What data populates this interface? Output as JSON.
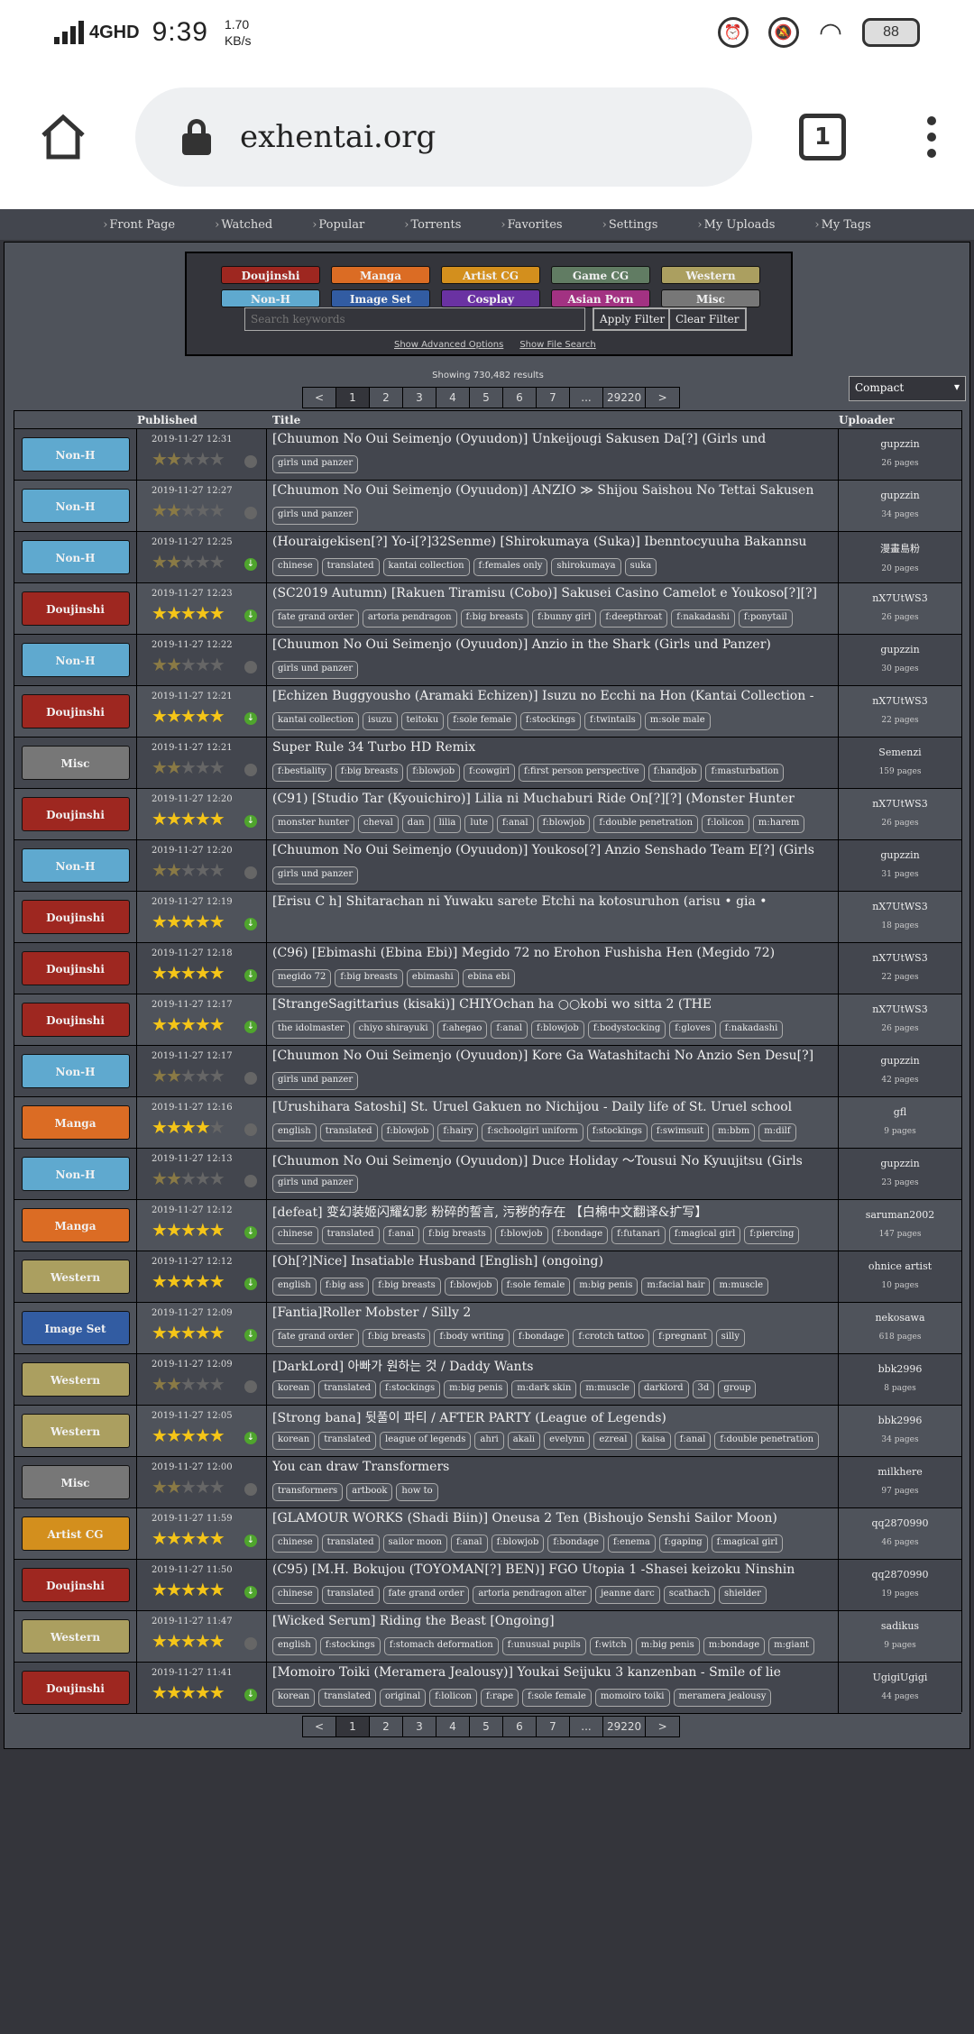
{
  "status": {
    "network": "4GHD",
    "time": "9:39",
    "speed_top": "1.70",
    "speed_bottom": "KB/s",
    "battery": "88"
  },
  "browser": {
    "url": "exhentai.org",
    "tab_count": "1"
  },
  "nav": [
    "Front Page",
    "Watched",
    "Popular",
    "Torrents",
    "Favorites",
    "Settings",
    "My Uploads",
    "My Tags"
  ],
  "categories": [
    {
      "label": "Doujinshi",
      "color": "#9e2720"
    },
    {
      "label": "Manga",
      "color": "#db6c24"
    },
    {
      "label": "Artist CG",
      "color": "#d38f1d"
    },
    {
      "label": "Game CG",
      "color": "#617c63"
    },
    {
      "label": "Western",
      "color": "#ab9f60"
    },
    {
      "label": "Non-H",
      "color": "#5fa9cf"
    },
    {
      "label": "Image Set",
      "color": "#325ca2"
    },
    {
      "label": "Cosplay",
      "color": "#6a32a2"
    },
    {
      "label": "Asian Porn",
      "color": "#a23282"
    },
    {
      "label": "Misc",
      "color": "#777777"
    }
  ],
  "search": {
    "placeholder": "Search keywords",
    "apply": "Apply Filter",
    "clear": "Clear Filter",
    "advanced": "Show Advanced Options",
    "file": "Show File Search"
  },
  "showing": "Showing 730,482 results",
  "pager": [
    "<",
    "1",
    "2",
    "3",
    "4",
    "5",
    "6",
    "7",
    "...",
    "29220",
    ">"
  ],
  "view_mode": "Compact",
  "columns": {
    "published": "Published",
    "title": "Title",
    "uploader": "Uploader"
  },
  "rows": [
    {
      "cat": "Non-H",
      "color": "#5fa9cf",
      "date": "2019-11-27 12:31",
      "rating": 2,
      "dl": false,
      "title": "[Chuumon No Oui Seimenjo (Oyuudon)] Unkeijougi Sakusen Da[?] (Girls und",
      "tags": [
        "girls und panzer"
      ],
      "uploader": "gupzzin",
      "pages": "26 pages"
    },
    {
      "cat": "Non-H",
      "color": "#5fa9cf",
      "date": "2019-11-27 12:27",
      "rating": 2,
      "dl": false,
      "title": "[Chuumon No Oui Seimenjo (Oyuudon)] ANZIO ≫ Shijou Saishou No Tettai Sakusen",
      "tags": [
        "girls und panzer"
      ],
      "uploader": "gupzzin",
      "pages": "34 pages"
    },
    {
      "cat": "Non-H",
      "color": "#5fa9cf",
      "date": "2019-11-27 12:25",
      "rating": 2,
      "dl": true,
      "title": "(Houraigekisen[?] Yo-i[?]32Senme) [Shirokumaya (Suka)] Ibenntocyuuha Bakannsu",
      "tags": [
        "chinese",
        "translated",
        "kantai collection",
        "f:females only",
        "shirokumaya",
        "suka"
      ],
      "uploader": "漫畫島粉",
      "pages": "20 pages"
    },
    {
      "cat": "Doujinshi",
      "color": "#9e2720",
      "date": "2019-11-27 12:23",
      "rating": 5,
      "dl": true,
      "title": "(SC2019 Autumn) [Rakuen Tiramisu (Cobo)] Sakusei Casino Camelot e Youkoso[?][?]",
      "tags": [
        "fate grand order",
        "artoria pendragon",
        "f:big breasts",
        "f:bunny girl",
        "f:deepthroat",
        "f:nakadashi",
        "f:ponytail"
      ],
      "uploader": "nX7UtWS3",
      "pages": "26 pages"
    },
    {
      "cat": "Non-H",
      "color": "#5fa9cf",
      "date": "2019-11-27 12:22",
      "rating": 2,
      "dl": false,
      "title": "[Chuumon No Oui Seimenjo (Oyuudon)] Anzio in the Shark (Girls und Panzer)",
      "tags": [
        "girls und panzer"
      ],
      "uploader": "gupzzin",
      "pages": "30 pages"
    },
    {
      "cat": "Doujinshi",
      "color": "#9e2720",
      "date": "2019-11-27 12:21",
      "rating": 5,
      "dl": true,
      "title": "[Echizen Buggyousho (Aramaki Echizen)] Isuzu no Ecchi na Hon (Kantai Collection -",
      "tags": [
        "kantai collection",
        "isuzu",
        "teitoku",
        "f:sole female",
        "f:stockings",
        "f:twintails",
        "m:sole male"
      ],
      "uploader": "nX7UtWS3",
      "pages": "22 pages"
    },
    {
      "cat": "Misc",
      "color": "#777777",
      "date": "2019-11-27 12:21",
      "rating": 2,
      "dl": false,
      "title": "Super Rule 34 Turbo HD Remix",
      "tags": [
        "f:bestiality",
        "f:big breasts",
        "f:blowjob",
        "f:cowgirl",
        "f:first person perspective",
        "f:handjob",
        "f:masturbation"
      ],
      "uploader": "Semenzi",
      "pages": "159 pages"
    },
    {
      "cat": "Doujinshi",
      "color": "#9e2720",
      "date": "2019-11-27 12:20",
      "rating": 5,
      "dl": true,
      "title": "(C91) [Studio Tar (Kyouichiro)] Lilia ni Muchaburi Ride On[?][?] (Monster Hunter",
      "tags": [
        "monster hunter",
        "cheval",
        "dan",
        "lilia",
        "lute",
        "f:anal",
        "f:blowjob",
        "f:double penetration",
        "f:lolicon",
        "m:harem"
      ],
      "uploader": "nX7UtWS3",
      "pages": "26 pages"
    },
    {
      "cat": "Non-H",
      "color": "#5fa9cf",
      "date": "2019-11-27 12:20",
      "rating": 2,
      "dl": false,
      "title": "[Chuumon No Oui Seimenjo (Oyuudon)] Youkoso[?] Anzio Senshado Team E[?] (Girls",
      "tags": [
        "girls und panzer"
      ],
      "uploader": "gupzzin",
      "pages": "31 pages"
    },
    {
      "cat": "Doujinshi",
      "color": "#9e2720",
      "date": "2019-11-27 12:19",
      "rating": 5,
      "dl": true,
      "title": "[Erisu C h] Shitarachan ni Yuwaku sarete Etchi na kotosuruhon (arisu • gia •",
      "tags": [],
      "uploader": "nX7UtWS3",
      "pages": "18 pages"
    },
    {
      "cat": "Doujinshi",
      "color": "#9e2720",
      "date": "2019-11-27 12:18",
      "rating": 5,
      "dl": true,
      "title": "(C96) [Ebimashi (Ebina Ebi)] Megido 72 no Erohon Fushisha Hen (Megido 72)",
      "tags": [
        "megido 72",
        "f:big breasts",
        "ebimashi",
        "ebina ebi"
      ],
      "uploader": "nX7UtWS3",
      "pages": "22 pages"
    },
    {
      "cat": "Doujinshi",
      "color": "#9e2720",
      "date": "2019-11-27 12:17",
      "rating": 5,
      "dl": true,
      "title": "[StrangeSagittarius (kisaki)] CHIYOchan ha ○○kobi wo sitta 2 (THE",
      "tags": [
        "the idolmaster",
        "chiyo shirayuki",
        "f:ahegao",
        "f:anal",
        "f:blowjob",
        "f:bodystocking",
        "f:gloves",
        "f:nakadashi"
      ],
      "uploader": "nX7UtWS3",
      "pages": "26 pages"
    },
    {
      "cat": "Non-H",
      "color": "#5fa9cf",
      "date": "2019-11-27 12:17",
      "rating": 2,
      "dl": false,
      "title": "[Chuumon No Oui Seimenjo (Oyuudon)] Kore Ga Watashitachi No Anzio Sen Desu[?]",
      "tags": [
        "girls und panzer"
      ],
      "uploader": "gupzzin",
      "pages": "42 pages"
    },
    {
      "cat": "Manga",
      "color": "#db6c24",
      "date": "2019-11-27 12:16",
      "rating": 4,
      "dl": false,
      "title": "[Urushihara Satoshi] St. Uruel Gakuen no Nichijou - Daily life of St. Uruel school",
      "tags": [
        "english",
        "translated",
        "f:blowjob",
        "f:hairy",
        "f:schoolgirl uniform",
        "f:stockings",
        "f:swimsuit",
        "m:bbm",
        "m:dilf"
      ],
      "uploader": "gfl",
      "pages": "9 pages"
    },
    {
      "cat": "Non-H",
      "color": "#5fa9cf",
      "date": "2019-11-27 12:13",
      "rating": 2,
      "dl": false,
      "title": "[Chuumon No Oui Seimenjo (Oyuudon)] Duce Holiday ～Tousui No Kyuujitsu (Girls",
      "tags": [
        "girls und panzer"
      ],
      "uploader": "gupzzin",
      "pages": "23 pages"
    },
    {
      "cat": "Manga",
      "color": "#db6c24",
      "date": "2019-11-27 12:12",
      "rating": 5,
      "dl": true,
      "title": "[defeat] 变幻装姬闪耀幻影 粉碎的誓言, 污秽的存在 【白棉中文翻译&扩写】",
      "tags": [
        "chinese",
        "translated",
        "f:anal",
        "f:big breasts",
        "f:blowjob",
        "f:bondage",
        "f:futanari",
        "f:magical girl",
        "f:piercing"
      ],
      "uploader": "saruman2002",
      "pages": "147 pages"
    },
    {
      "cat": "Western",
      "color": "#ab9f60",
      "date": "2019-11-27 12:12",
      "rating": 5,
      "dl": true,
      "title": "[Oh[?]Nice] Insatiable Husband [English] (ongoing)",
      "tags": [
        "english",
        "f:big ass",
        "f:big breasts",
        "f:blowjob",
        "f:sole female",
        "m:big penis",
        "m:facial hair",
        "m:muscle"
      ],
      "uploader": "ohnice artist",
      "pages": "10 pages"
    },
    {
      "cat": "Image Set",
      "color": "#325ca2",
      "date": "2019-11-27 12:09",
      "rating": 5,
      "dl": true,
      "title": "[Fantia]Roller Mobster / Silly 2",
      "tags": [
        "fate grand order",
        "f:big breasts",
        "f:body writing",
        "f:bondage",
        "f:crotch tattoo",
        "f:pregnant",
        "silly"
      ],
      "uploader": "nekosawa",
      "pages": "618 pages"
    },
    {
      "cat": "Western",
      "color": "#ab9f60",
      "date": "2019-11-27 12:09",
      "rating": 2,
      "dl": false,
      "title": "[DarkLord] 아빠가 원하는 것 / Daddy Wants",
      "tags": [
        "korean",
        "translated",
        "f:stockings",
        "m:big penis",
        "m:dark skin",
        "m:muscle",
        "darklord",
        "3d",
        "group"
      ],
      "uploader": "bbk2996",
      "pages": "8 pages"
    },
    {
      "cat": "Western",
      "color": "#ab9f60",
      "date": "2019-11-27 12:05",
      "rating": 5,
      "dl": true,
      "title": "[Strong bana] 뒷풀이 파티 / AFTER PARTY (League of Legends)",
      "tags": [
        "korean",
        "translated",
        "league of legends",
        "ahri",
        "akali",
        "evelynn",
        "ezreal",
        "kaisa",
        "f:anal",
        "f:double penetration"
      ],
      "uploader": "bbk2996",
      "pages": "34 pages"
    },
    {
      "cat": "Misc",
      "color": "#777777",
      "date": "2019-11-27 12:00",
      "rating": 2,
      "dl": false,
      "title": "You can draw Transformers",
      "tags": [
        "transformers",
        "artbook",
        "how to"
      ],
      "uploader": "milkhere",
      "pages": "97 pages"
    },
    {
      "cat": "Artist CG",
      "color": "#d38f1d",
      "date": "2019-11-27 11:59",
      "rating": 5,
      "dl": true,
      "title": "[GLAMOUR WORKS (Shadi Biin)] Oneusa 2 Ten (Bishoujo Senshi Sailor Moon)",
      "tags": [
        "chinese",
        "translated",
        "sailor moon",
        "f:anal",
        "f:blowjob",
        "f:bondage",
        "f:enema",
        "f:gaping",
        "f:magical girl"
      ],
      "uploader": "qq2870990",
      "pages": "46 pages"
    },
    {
      "cat": "Doujinshi",
      "color": "#9e2720",
      "date": "2019-11-27 11:50",
      "rating": 5,
      "dl": true,
      "title": "(C95) [M.H. Bokujou (TOYOMAN[?] BEN)] FGO Utopia 1 -Shasei keizoku Ninshin",
      "tags": [
        "chinese",
        "translated",
        "fate grand order",
        "artoria pendragon alter",
        "jeanne darc",
        "scathach",
        "shielder"
      ],
      "uploader": "qq2870990",
      "pages": "19 pages"
    },
    {
      "cat": "Western",
      "color": "#ab9f60",
      "date": "2019-11-27 11:47",
      "rating": 5,
      "dl": false,
      "title": "[Wicked Serum] Riding the Beast [Ongoing]",
      "tags": [
        "english",
        "f:stockings",
        "f:stomach deformation",
        "f:unusual pupils",
        "f:witch",
        "m:big penis",
        "m:bondage",
        "m:giant"
      ],
      "uploader": "sadikus",
      "pages": "9 pages"
    },
    {
      "cat": "Doujinshi",
      "color": "#9e2720",
      "date": "2019-11-27 11:41",
      "rating": 5,
      "dl": true,
      "title": "[Momoiro Toiki (Meramera Jealousy)] Youkai Seijuku 3 kanzenban - Smile of lie",
      "tags": [
        "korean",
        "translated",
        "original",
        "f:lolicon",
        "f:rape",
        "f:sole female",
        "momoiro toiki",
        "meramera jealousy"
      ],
      "uploader": "UgigiUgigi",
      "pages": "44 pages"
    }
  ]
}
